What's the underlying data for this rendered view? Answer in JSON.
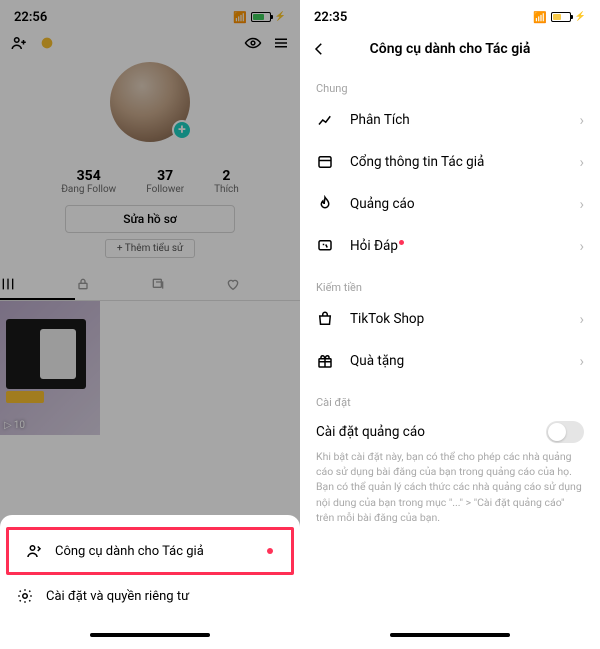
{
  "left": {
    "status": {
      "time": "22:56"
    },
    "stats": [
      {
        "num": "354",
        "lbl": "Đang Follow"
      },
      {
        "num": "37",
        "lbl": "Follower"
      },
      {
        "num": "2",
        "lbl": "Thích"
      }
    ],
    "edit_profile": "Sửa hồ sơ",
    "add_bio": "+ Thêm tiểu sử",
    "tile_views": "10",
    "sheet": {
      "creator_tools": "Công cụ dành cho Tác giả",
      "settings_privacy": "Cài đặt và quyền riêng tư"
    }
  },
  "right": {
    "status": {
      "time": "22:35"
    },
    "title": "Công cụ dành cho Tác giả",
    "sections": {
      "general": "Chung",
      "monetize": "Kiếm tiền",
      "settings": "Cài đặt"
    },
    "rows": {
      "analytics": "Phân Tích",
      "creator_portal": "Cổng thông tin Tác giả",
      "ads": "Quảng cáo",
      "qa": "Hỏi Đáp",
      "shop": "TikTok Shop",
      "gifts": "Quà tặng"
    },
    "ad_setting_label": "Cài đặt quảng cáo",
    "ad_setting_desc": "Khi bật cài đặt này, bạn có thể cho phép các nhà quảng cáo sử dụng bài đăng của bạn trong quảng cáo của họ. Bạn có thể quản lý cách thức các nhà quảng cáo sử dụng nội dung của bạn trong mục \"...\" > \"Cài đặt quảng cáo\" trên mỗi bài đăng của bạn."
  }
}
